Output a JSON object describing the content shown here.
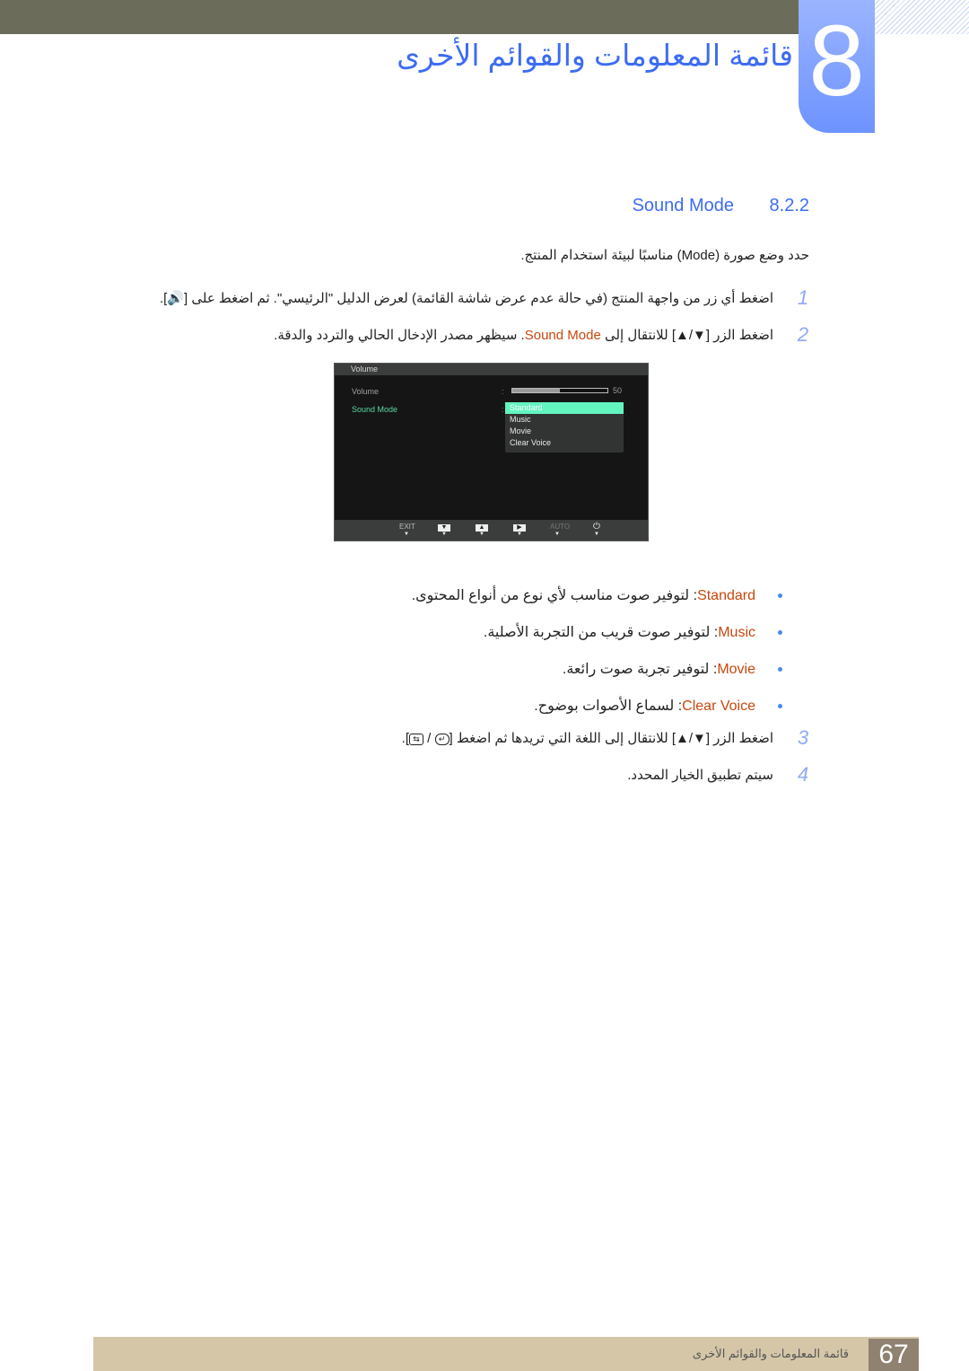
{
  "header": {
    "chapter_number": "8",
    "chapter_title": "قائمة المعلومات والقوائم الأخرى",
    "colors": {
      "accent": "#3d6cf2",
      "top_bar": "#6c6c5a",
      "tab": "#7b9dff"
    }
  },
  "section": {
    "number": "8.2.2",
    "title": "Sound Mode"
  },
  "intro": "حدد وضع صورة (Mode) مناسبًا لبيئة استخدام المنتج.",
  "steps": [
    {
      "num": "1",
      "text": "اضغط أي زر من واجهة المنتج (في حالة عدم عرض شاشة القائمة) لعرض الدليل \"الرئيسي\". ثم اضغط على [",
      "icon": "speaker-icon",
      "text_end": "]."
    },
    {
      "num": "2",
      "text_a": "اضغط الزر [▼/▲] للانتقال إلى ",
      "highlight": "Sound Mode",
      "text_b": ". سيظهر مصدر الإدخال الحالي والتردد والدقة."
    },
    {
      "num": "3",
      "text": "اضغط الزر [▼/▲] للانتقال إلى اللغة التي تريدها ثم اضغط [",
      "text_end": "]."
    },
    {
      "num": "4",
      "text": "سيتم تطبيق الخيار المحدد."
    }
  ],
  "osd": {
    "header": "Volume",
    "rows": [
      {
        "label": "Volume",
        "value": "50",
        "progress": 0.5
      },
      {
        "label": "Sound Mode"
      }
    ],
    "colon": ":",
    "options": [
      "Standard",
      "Music",
      "Movie",
      "Clear Voice"
    ],
    "selected": "Standard",
    "footer_buttons": [
      {
        "label": "EXIT",
        "icon": "exit"
      },
      {
        "label": "▼",
        "icon": "down-arrow-icon"
      },
      {
        "label": "▲",
        "icon": "up-arrow-icon"
      },
      {
        "label": "▶",
        "icon": "right-arrow-icon"
      },
      {
        "label": "AUTO",
        "icon": "auto"
      },
      {
        "label": "⏻",
        "icon": "power-icon"
      }
    ]
  },
  "bullets": [
    {
      "label": "Standard",
      "text": ": لتوفير صوت مناسب لأي نوع من أنواع المحتوى."
    },
    {
      "label": "Music",
      "text": ": لتوفير صوت قريب من التجربة الأصلية."
    },
    {
      "label": "Movie",
      "text": ": لتوفير تجربة صوت رائعة."
    },
    {
      "label": "Clear Voice",
      "text": ": لسماع الأصوات بوضوح."
    }
  ],
  "footer": {
    "title": "قائمة المعلومات والقوائم الأخرى",
    "page_number": "67"
  }
}
